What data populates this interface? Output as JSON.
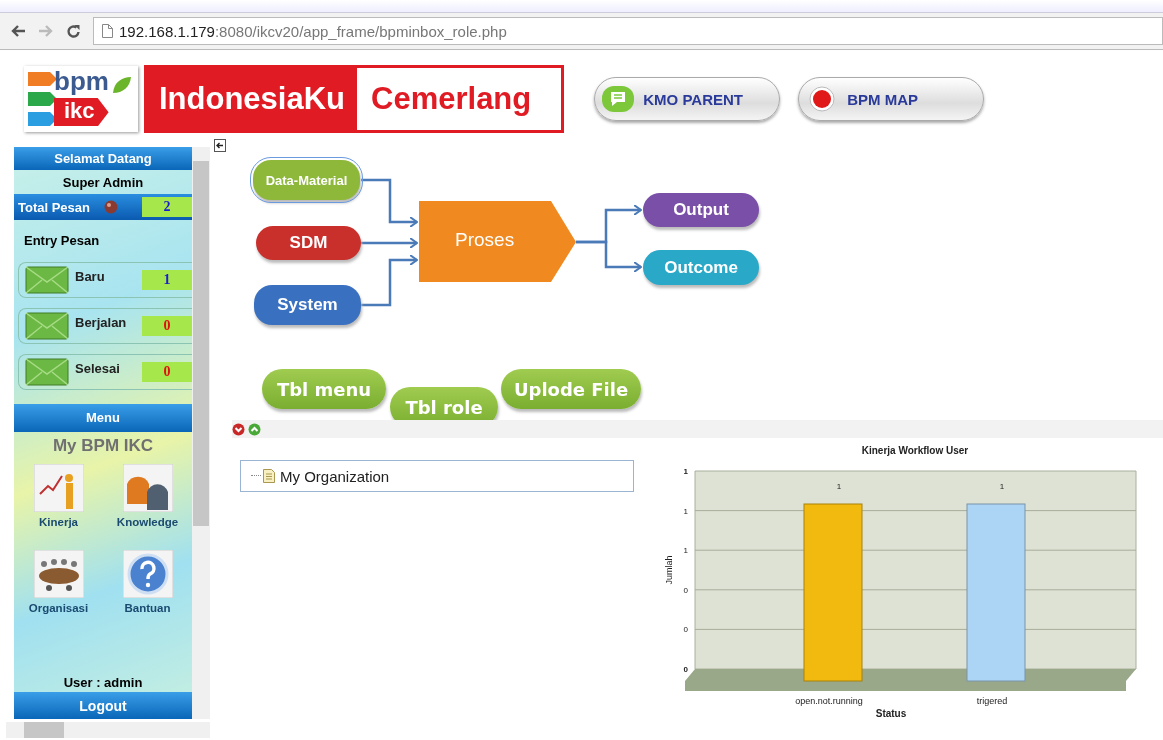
{
  "browser": {
    "url_host": "192.168.1.179",
    "url_path": ":8080/ikcv20/app_frame/bpminbox_role.php"
  },
  "header": {
    "logo": {
      "top": "bpm",
      "bottom": "ikc"
    },
    "banner": {
      "left": "IndonesiaKu",
      "right": "Cemerlang"
    },
    "buttons": [
      {
        "label": "KMO PARENT",
        "kind": "chat"
      },
      {
        "label": "BPM MAP",
        "kind": "record"
      }
    ]
  },
  "sidebar": {
    "welcome": "Selamat Datang",
    "role": "Super Admin",
    "total": {
      "label": "Total Pesan",
      "count": "2",
      "color": "#1a1ad0"
    },
    "entry_title": "Entry Pesan",
    "messages": [
      {
        "label": "Baru",
        "count": "1",
        "color": "#1a1ad0"
      },
      {
        "label": "Berjalan",
        "count": "0",
        "color": "#e01010"
      },
      {
        "label": "Selesai",
        "count": "0",
        "color": "#e01010"
      }
    ],
    "menu_title": "Menu",
    "app_title": "My BPM IKC",
    "tiles": [
      {
        "label": "Kinerja",
        "kind": "chart"
      },
      {
        "label": "Knowledge",
        "kind": "heads"
      },
      {
        "label": "Organisasi",
        "kind": "meeting"
      },
      {
        "label": "Bantuan",
        "kind": "help"
      }
    ],
    "user": "User : admin",
    "logout": "Logout"
  },
  "diagram": {
    "inputs": [
      {
        "label": "Data-Material",
        "color": "#8db83a",
        "selected": true
      },
      {
        "label": "SDM",
        "color": "#c9302c",
        "selected": false
      },
      {
        "label": "System",
        "color": "#3a70c0",
        "selected": false
      }
    ],
    "process": {
      "label": "Proses"
    },
    "outputs": [
      {
        "label": "Output",
        "color": "#7a4fa8"
      },
      {
        "label": "Outcome",
        "color": "#2aa8c8"
      }
    ],
    "tables": [
      {
        "label": "Tbl menu"
      },
      {
        "label": "Tbl role"
      },
      {
        "label": "Uplode File"
      }
    ]
  },
  "tree": {
    "items": [
      {
        "label": "My Organization"
      }
    ]
  },
  "chart": {
    "chart_data": {
      "type": "bar",
      "title": "Kinerja Workflow User",
      "xlabel": "Status",
      "ylabel": "Jumlah",
      "categories": [
        "open.not.running",
        "trigered"
      ],
      "series": [
        {
          "color": "#f2b90f",
          "values": [
            1,
            null
          ]
        },
        {
          "color": "#acd4f4",
          "values": [
            null,
            1
          ]
        }
      ],
      "grid": true,
      "ylim": [
        0,
        1.2
      ],
      "yticks": [
        {
          "value": 0,
          "label": "0"
        },
        {
          "value": 0.24,
          "label": "0"
        },
        {
          "value": 0.48,
          "label": "0"
        },
        {
          "value": 0.72,
          "label": "1"
        },
        {
          "value": 0.96,
          "label": "1"
        },
        {
          "value": 1.2,
          "label": "1"
        }
      ],
      "data_labels": true
    }
  }
}
